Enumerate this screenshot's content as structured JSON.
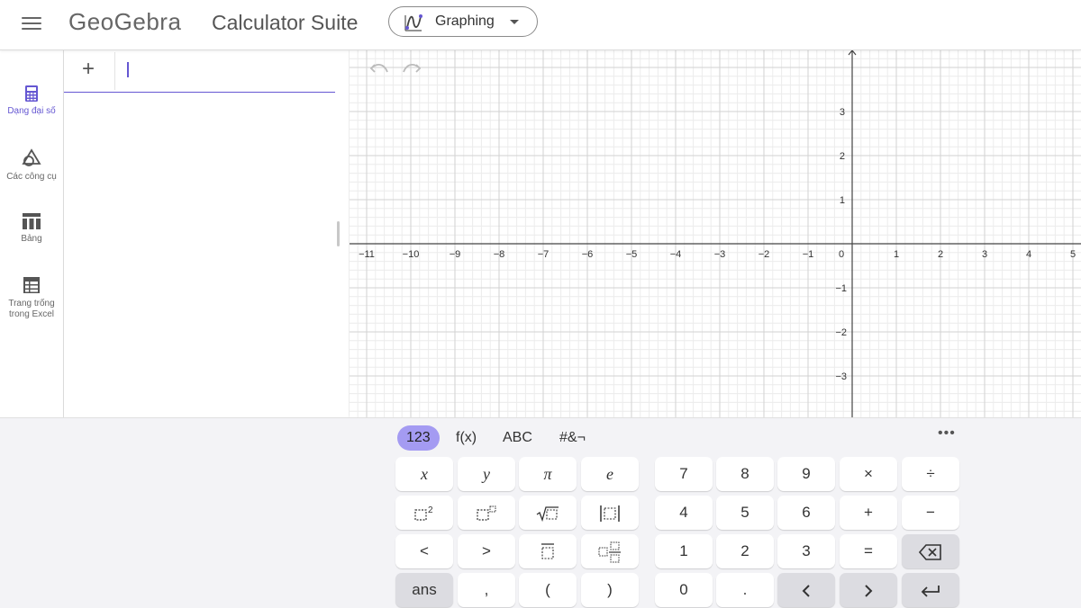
{
  "header": {
    "logo_text": "GeoGebra",
    "suite_title": "Calculator Suite",
    "app_switch_label": "Graphing"
  },
  "sidenav": {
    "items": [
      {
        "label": "Dạng đại số",
        "icon": "calculator-icon",
        "active": true
      },
      {
        "label": "Các công cụ",
        "icon": "shapes-tools-icon",
        "active": false
      },
      {
        "label": "Bảng",
        "icon": "table-icon",
        "active": false
      },
      {
        "label": "Trang trống trong Excel",
        "icon": "spreadsheet-icon",
        "active": false
      }
    ]
  },
  "algebra": {
    "add_label": "+",
    "input_value": ""
  },
  "graphics": {
    "x_ticks": [
      "−11",
      "−10",
      "−9",
      "−8",
      "−7",
      "−6",
      "−5",
      "−4",
      "−3",
      "−2",
      "−1",
      "0",
      "1",
      "2",
      "3",
      "4",
      "5"
    ],
    "y_ticks_pos": [
      "3",
      "2",
      "1"
    ],
    "y_ticks_neg": [
      "−1",
      "−2",
      "−3"
    ]
  },
  "keyboard": {
    "tabs": [
      "123",
      "f(x)",
      "ABC",
      "#&¬"
    ],
    "active_tab": "123",
    "more_label": "•••",
    "row1": [
      "x",
      "y",
      "π",
      "e",
      "7",
      "8",
      "9",
      "×",
      "÷"
    ],
    "row2_numbers": [
      "4",
      "5",
      "6",
      "+",
      "−"
    ],
    "row3": [
      "<",
      ">",
      "1",
      "2",
      "3",
      "="
    ],
    "row4": [
      "ans",
      ",",
      "(",
      ")",
      "0",
      "."
    ],
    "colors": {
      "active_tab": "#a49bf2",
      "accent": "#6557d2",
      "gray_key": "#dcdce1"
    }
  }
}
